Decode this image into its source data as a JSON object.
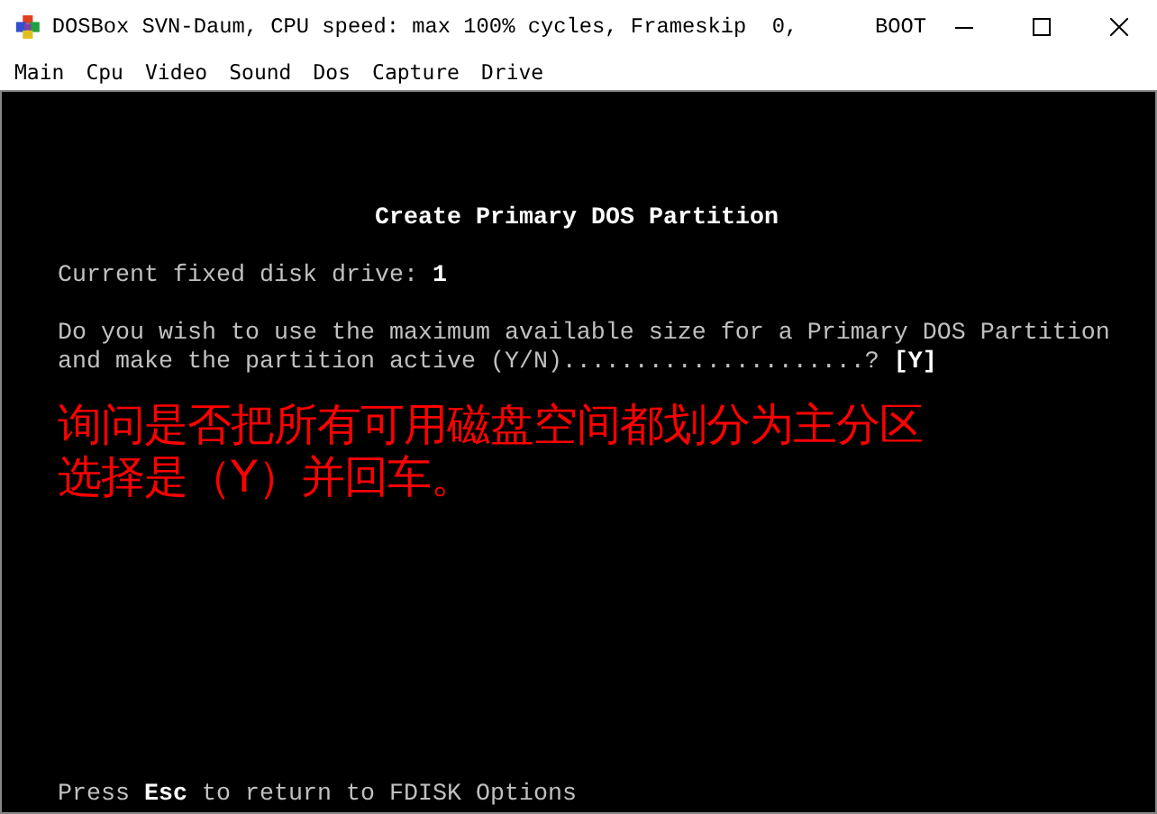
{
  "window": {
    "title": "DOSBox SVN-Daum, CPU speed: max 100% cycles, Frameskip  0,      BOOT"
  },
  "menu": [
    "Main",
    "Cpu",
    "Video",
    "Sound",
    "Dos",
    "Capture",
    "Drive"
  ],
  "screen": {
    "heading": "Create Primary DOS Partition",
    "drive_line": "Current fixed disk drive: **1**",
    "question_lines": [
      "Do you wish to use the maximum available size for a Primary DOS Partition",
      "and make the partition active (Y/N).....................?"
    ],
    "answer": "[Y]",
    "annotation_lines": [
      "询问是否把所有可用磁盘空间都划分为主分区",
      "选择是（Y）并回车。"
    ],
    "footer": "Press **Esc** to return to FDISK Options"
  }
}
